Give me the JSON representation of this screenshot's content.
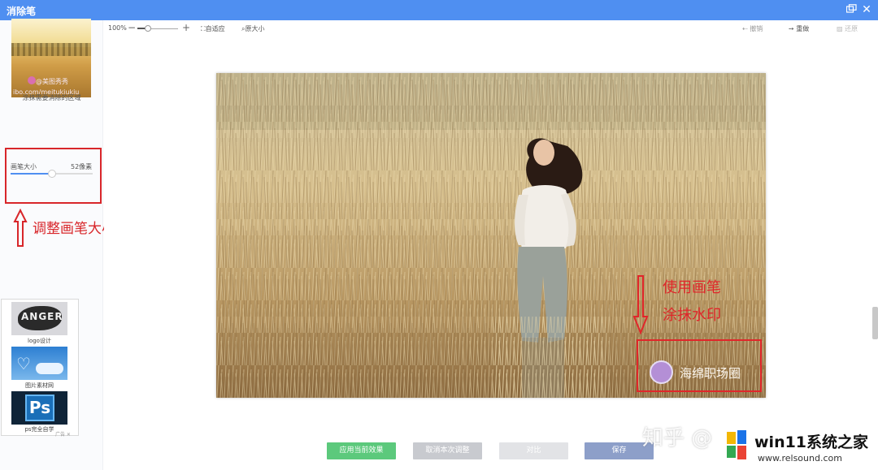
{
  "window": {
    "title": "消除笔",
    "restore_icon": "restore-window-icon",
    "close_glyph": "✕"
  },
  "sidebar": {
    "hint": "涂抹需要消除的区域",
    "thumbnail_watermark_line1": "@美图秀秀",
    "thumbnail_watermark_line2": "ibo.com/meitukiukiu",
    "brush": {
      "label": "画笔大小",
      "value_text": "52像素",
      "level": 0.5
    },
    "annotation": "调整画笔大小",
    "ads": [
      {
        "label": "logo设计",
        "image_text": "ANGER"
      },
      {
        "label": "图片素材网",
        "image_text": ""
      },
      {
        "label": "ps完全自学",
        "image_text": "Ps"
      }
    ],
    "ad_flag": "广告 ✕"
  },
  "toolbar": {
    "zoom": "100%",
    "zoom_minus": "−",
    "zoom_plus": "+",
    "zoom_level": 0.25,
    "fit": "自适应",
    "original": "原大小",
    "undo": "撤销",
    "redo": "重做",
    "restore": "还原"
  },
  "canvas": {
    "watermark_text": "海绵职场圈",
    "annotation_line1": "使用画笔",
    "annotation_line2": "涂抹水印"
  },
  "buttons": {
    "apply": "应用当前效果",
    "cancel": "取消本次调整",
    "compare": "对比",
    "save": "保存"
  },
  "overlay": {
    "site_watermark": "知乎 @",
    "brand": "win11系统之家",
    "url": "www.relsound.com"
  },
  "colors": {
    "accent": "#4f8ff1",
    "annotation_red": "#e0262a",
    "apply_green": "#5cc97c",
    "save_blue": "#8d9fc9"
  }
}
